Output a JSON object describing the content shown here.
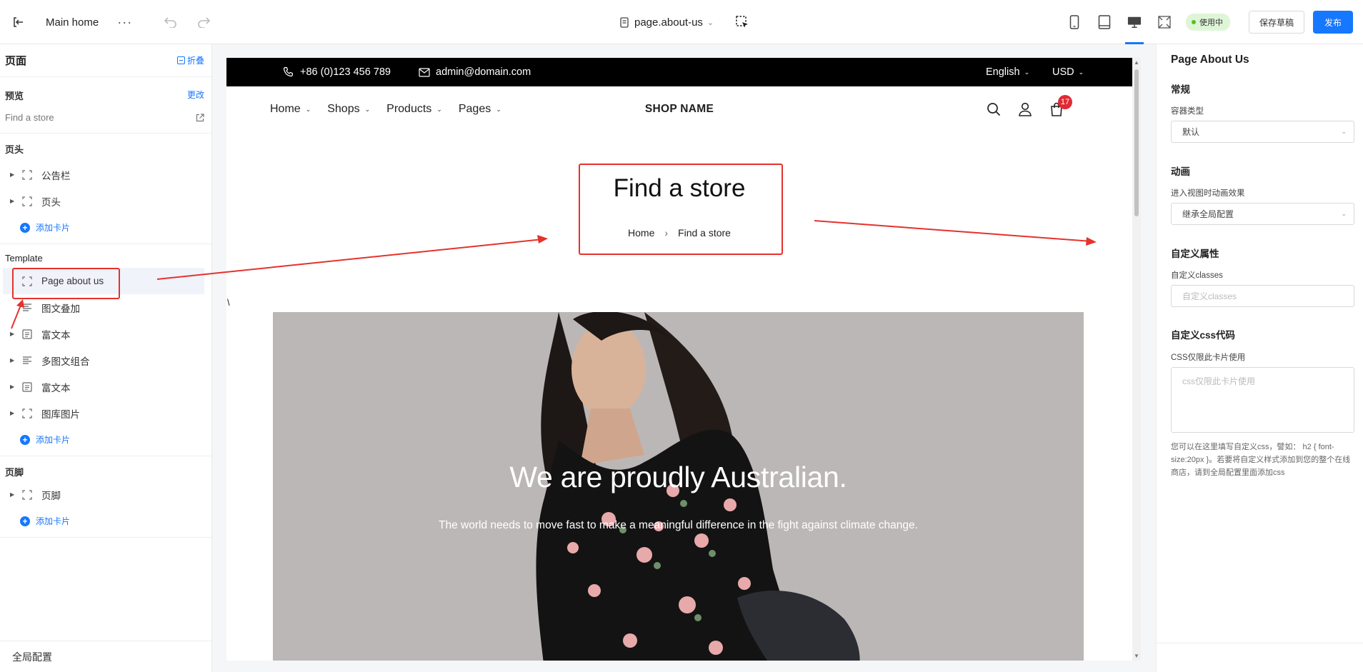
{
  "topbar": {
    "title": "Main home",
    "more": "···",
    "page_selector": "page.about-us",
    "status": "使用中",
    "save_draft": "保存草稿",
    "publish": "发布"
  },
  "sidebar": {
    "header": "页面",
    "collapse": "折叠",
    "preview_title": "预览",
    "preview_change": "更改",
    "preview_value": "Find a store",
    "header_section": "页头",
    "header_items": [
      "公告栏",
      "页头"
    ],
    "add_card": "添加卡片",
    "template_section": "Template",
    "template_items": [
      "Page about us",
      "图文叠加",
      "富文本",
      "多图文组合",
      "富文本",
      "图库图片"
    ],
    "footer_section": "页脚",
    "footer_items": [
      "页脚"
    ],
    "global_config": "全局配置",
    "stray_mark": "\\"
  },
  "site": {
    "phone": "+86 (0)123 456 789",
    "email": "admin@domain.com",
    "language": "English",
    "currency": "USD",
    "nav": [
      "Home",
      "Shops",
      "Products",
      "Pages"
    ],
    "shop_name": "SHOP NAME",
    "cart_count": "17",
    "page_title": "Find a store",
    "breadcrumb_home": "Home",
    "breadcrumb_sep": "›",
    "breadcrumb_current": "Find a store",
    "hero_title": "We are proudly Australian.",
    "hero_subtitle": "The world needs to move fast to make a meaningful difference in the fight against climate change."
  },
  "panel": {
    "title": "Page About Us",
    "general": "常规",
    "container_label": "容器类型",
    "container_value": "默认",
    "animation": "动画",
    "animation_label": "进入视图时动画效果",
    "animation_value": "继承全局配置",
    "custom_attr": "自定义属性",
    "classes_label": "自定义classes",
    "classes_placeholder": "自定义classes",
    "css_section": "自定义css代码",
    "css_label": "CSS仅限此卡片使用",
    "css_placeholder": "css仅限此卡片使用",
    "css_help": "您可以在这里填写自定义css，譬如： h2 { font-size:20px }。若要将自定义样式添加到您的整个在线商店，请到全局配置里面添加css"
  },
  "colors": {
    "accent": "#1677ff",
    "annotation": "#e5322d",
    "hero_bg": "#bdb8b8"
  }
}
